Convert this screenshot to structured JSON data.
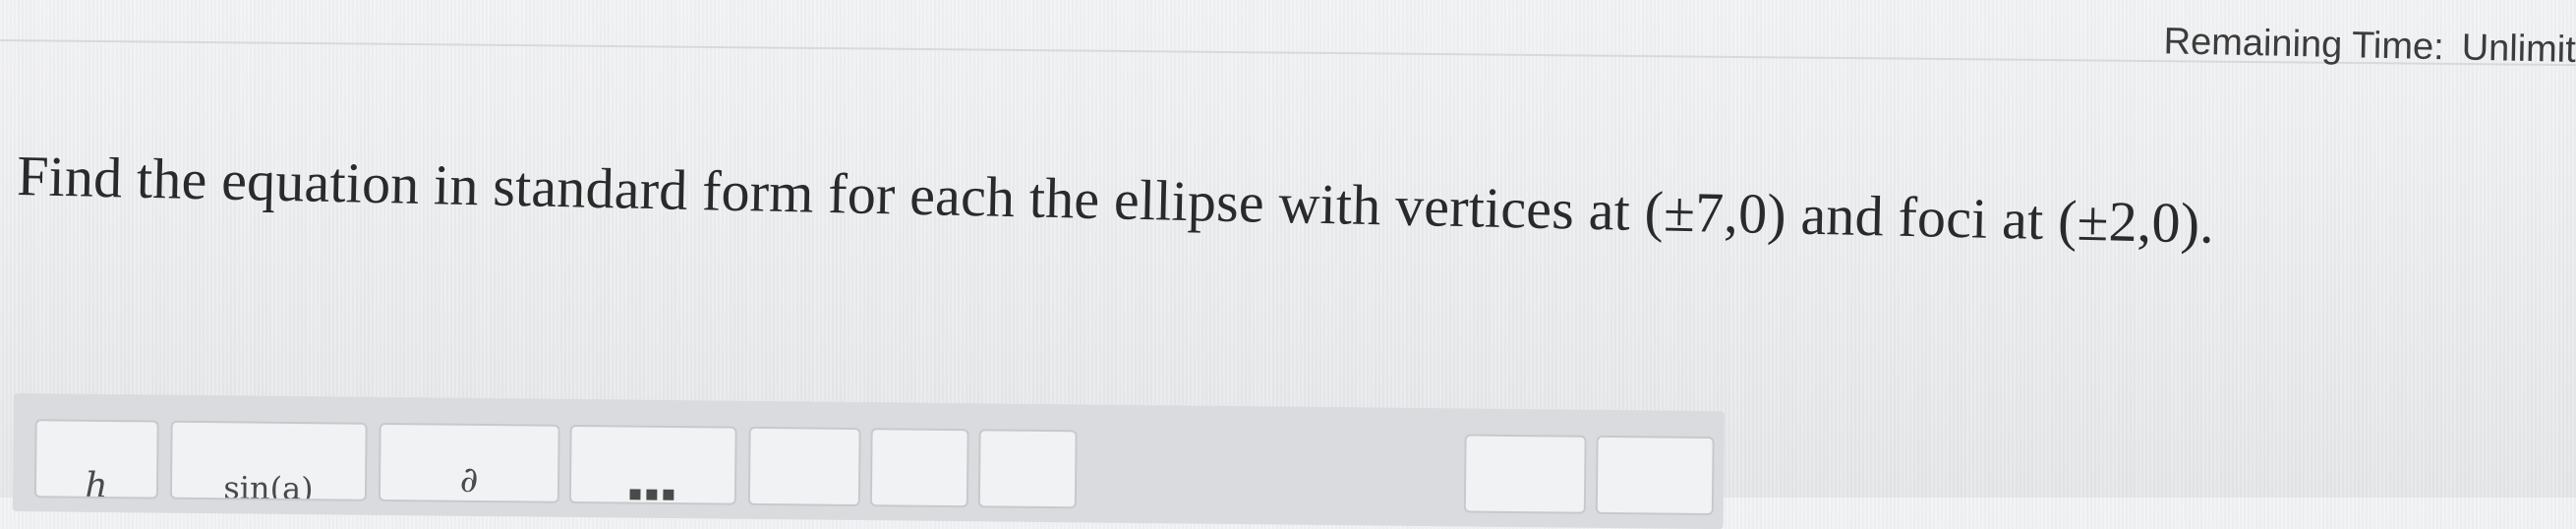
{
  "header": {
    "timer_label": "Remaining Time:",
    "timer_value": "Unlimit"
  },
  "question": {
    "text": "Find the equation in standard form for each the ellipse with vertices at (±7,0) and foci at (±2,0)."
  },
  "toolbar": {
    "buttons": [
      {
        "icon": "italic-h",
        "label": "h"
      },
      {
        "icon": "sine-function",
        "label": "sin(a)"
      },
      {
        "icon": "partial-derivative",
        "label": "∂"
      },
      {
        "icon": "matrix",
        "label": "▪▪▪"
      },
      {
        "icon": "blank-5",
        "label": ""
      },
      {
        "icon": "blank-6",
        "label": ""
      },
      {
        "icon": "blank-7",
        "label": ""
      },
      {
        "icon": "blank-8",
        "label": ""
      },
      {
        "icon": "blank-9",
        "label": ""
      }
    ]
  }
}
